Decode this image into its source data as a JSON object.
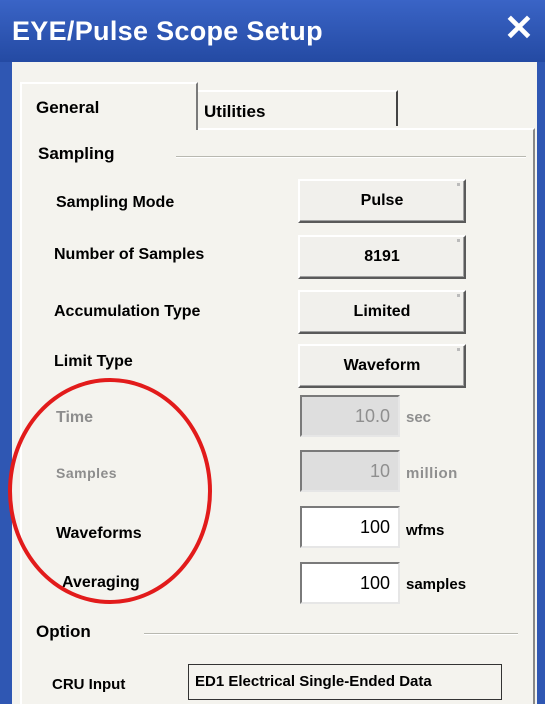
{
  "window": {
    "title": "EYE/Pulse Scope Setup",
    "close_symbol": "✕"
  },
  "tabs": [
    {
      "label": "General",
      "active": true
    },
    {
      "label": "Utilities",
      "active": false
    }
  ],
  "sampling": {
    "header": "Sampling",
    "sampling_mode": {
      "label": "Sampling Mode",
      "value": "Pulse"
    },
    "number_of_samples": {
      "label": "Number of Samples",
      "value": "8191"
    },
    "accumulation_type": {
      "label": "Accumulation Type",
      "value": "Limited"
    },
    "limit_type": {
      "label": "Limit Type",
      "value": "Waveform"
    },
    "time": {
      "label": "Time",
      "value": "10.0",
      "unit": "sec",
      "enabled": false
    },
    "samples": {
      "label": "Samples",
      "value": "10",
      "unit": "million",
      "enabled": false
    },
    "waveforms": {
      "label": "Waveforms",
      "value": "100",
      "unit": "wfms",
      "enabled": true
    },
    "averaging": {
      "label": "Averaging",
      "value": "100",
      "unit": "samples",
      "enabled": true
    }
  },
  "option": {
    "header": "Option",
    "cru_input": {
      "label": "CRU Input",
      "value": "ED1 Electrical Single-Ended Data"
    }
  },
  "colors": {
    "title_bar": "#2f57b3",
    "highlight_circle": "#e21b1b",
    "panel_bg": "#f4f3ee"
  }
}
